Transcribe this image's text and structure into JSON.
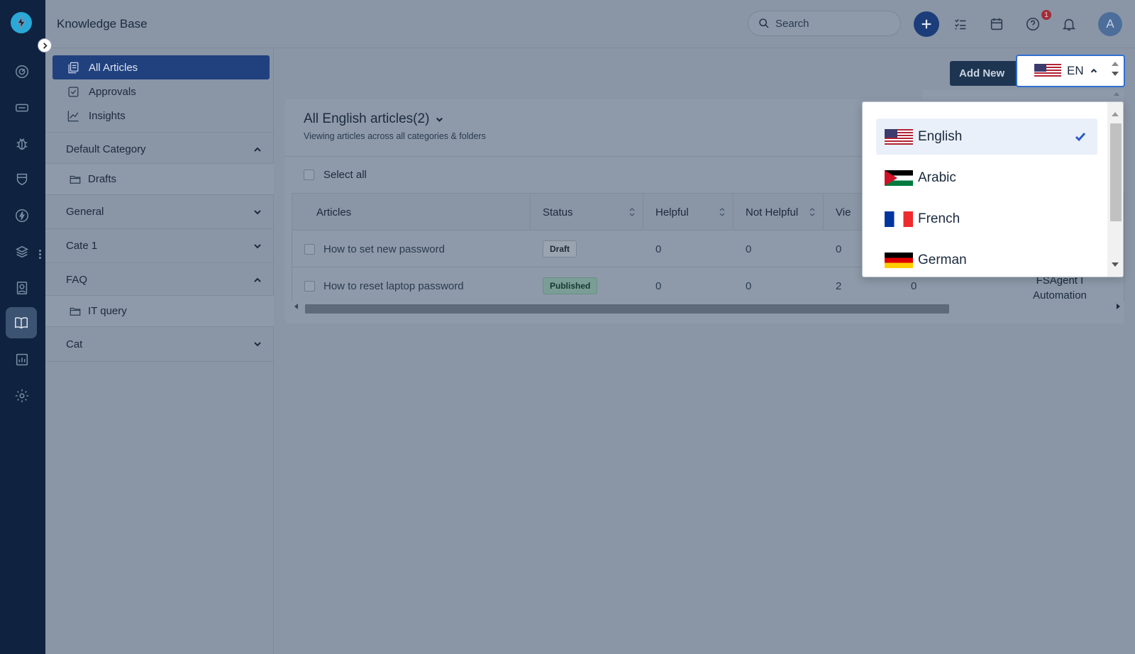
{
  "app": {
    "title": "Knowledge Base"
  },
  "header": {
    "search_placeholder": "Search",
    "help_badge": "1",
    "avatar_initial": "A"
  },
  "sidebar": {
    "items": [
      {
        "label": "All Articles",
        "icon": "articles-icon",
        "selected": true
      },
      {
        "label": "Approvals",
        "icon": "check-square-icon",
        "selected": false
      },
      {
        "label": "Insights",
        "icon": "chart-line-icon",
        "selected": false
      }
    ],
    "categories": [
      {
        "label": "Default Category",
        "expanded": true,
        "folders": [
          "Drafts"
        ]
      },
      {
        "label": "General",
        "expanded": false,
        "folders": []
      },
      {
        "label": "Cate 1",
        "expanded": false,
        "folders": []
      },
      {
        "label": "FAQ",
        "expanded": true,
        "folders": [
          "IT query"
        ]
      },
      {
        "label": "Cat",
        "expanded": false,
        "folders": []
      }
    ]
  },
  "toolbar": {
    "add_new_label": "Add New"
  },
  "language": {
    "current": "EN",
    "options": [
      {
        "label": "English",
        "flag": "us",
        "selected": true
      },
      {
        "label": "Arabic",
        "flag": "ps",
        "selected": false
      },
      {
        "label": "French",
        "flag": "fr",
        "selected": false
      },
      {
        "label": "German",
        "flag": "de",
        "selected": false
      }
    ]
  },
  "main": {
    "title": "All English articles(2)",
    "subtitle": "Viewing articles across all categories & folders",
    "select_all_label": "Select all",
    "columns": [
      "Articles",
      "Status",
      "Helpful",
      "Not Helpful",
      "Vie"
    ],
    "rows": [
      {
        "title": "How to set new password",
        "status": "Draft",
        "helpful": "0",
        "not_helpful": "0",
        "views": "0",
        "extra": ""
      },
      {
        "title": "How to reset laptop password",
        "status": "Published",
        "helpful": "0",
        "not_helpful": "0",
        "views": "2",
        "extra": "0"
      }
    ],
    "overflow_author_line1": "FSAgent I",
    "overflow_author_line2": "Automation"
  },
  "colors": {
    "accent": "#21417e",
    "rail": "#0f2340",
    "primary_button": "#1d3d7a",
    "check": "#2a5cc4"
  }
}
